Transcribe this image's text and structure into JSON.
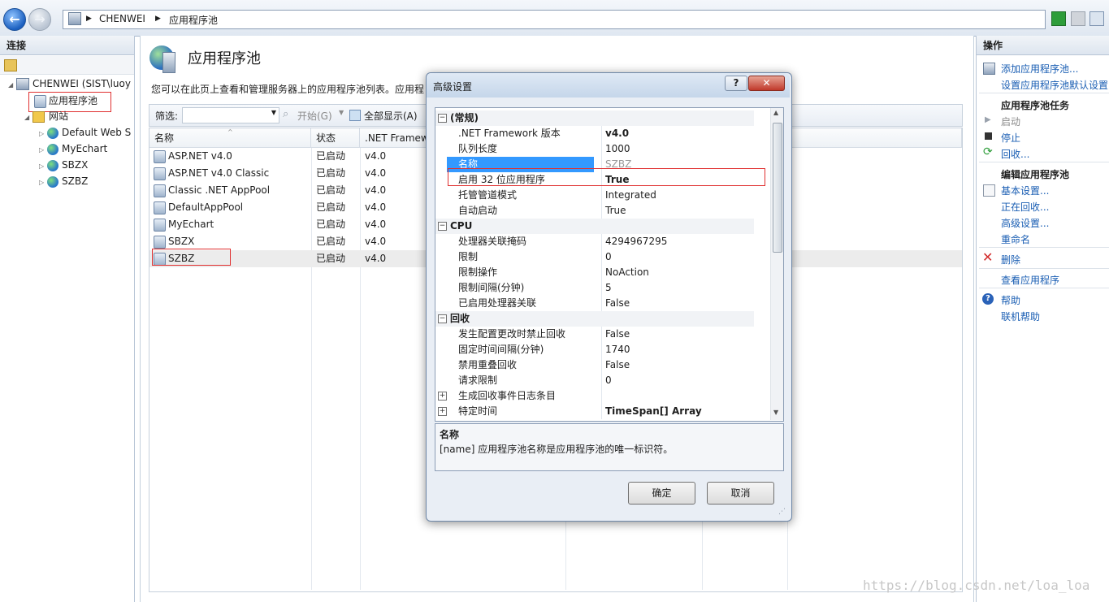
{
  "window": {
    "breadcrumb": [
      "CHENWEI",
      "应用程序池"
    ]
  },
  "connections": {
    "title": "连接",
    "server": "CHENWEI (SIST\\luoy",
    "app_pools": "应用程序池",
    "sites": "网站",
    "site_items": [
      "Default Web S",
      "MyEchart",
      "SBZX",
      "SZBZ"
    ]
  },
  "main": {
    "title": "应用程序池",
    "description": "您可以在此页上查看和管理服务器上的应用程序池列表。应用程",
    "filter_label": "筛选:",
    "start_label": "开始(G)",
    "show_all_label": "全部显示(A)",
    "columns": [
      "名称",
      "状态",
      ".NET Framew"
    ],
    "rows": [
      {
        "name": "ASP.NET v4.0",
        "status": "已启动",
        "net": "v4.0"
      },
      {
        "name": "ASP.NET v4.0 Classic",
        "status": "已启动",
        "net": "v4.0"
      },
      {
        "name": "Classic .NET AppPool",
        "status": "已启动",
        "net": "v4.0"
      },
      {
        "name": "DefaultAppPool",
        "status": "已启动",
        "net": "v4.0"
      },
      {
        "name": "MyEchart",
        "status": "已启动",
        "net": "v4.0"
      },
      {
        "name": "SBZX",
        "status": "已启动",
        "net": "v4.0"
      },
      {
        "name": "SZBZ",
        "status": "已启动",
        "net": "v4.0"
      }
    ]
  },
  "actions": {
    "title": "操作",
    "add_pool": "添加应用程序池...",
    "set_defaults": "设置应用程序池默认设置",
    "tasks_head": "应用程序池任务",
    "start": "启动",
    "stop": "停止",
    "recycle": "回收...",
    "edit_head": "编辑应用程序池",
    "basic_settings": "基本设置...",
    "recycling": "正在回收...",
    "advanced_settings": "高级设置...",
    "rename": "重命名",
    "delete": "删除",
    "view_apps": "查看应用程序",
    "help": "帮助",
    "online_help": "联机帮助"
  },
  "dialog": {
    "title": "高级设置",
    "help_btn": "?",
    "close_btn": "✕",
    "properties": [
      {
        "kind": "cat",
        "name": "(常规)"
      },
      {
        "kind": "prop",
        "name": ".NET Framework 版本",
        "value": "v4.0",
        "bold": true
      },
      {
        "kind": "prop",
        "name": "队列长度",
        "value": "1000"
      },
      {
        "kind": "prop",
        "name": "名称",
        "value": "SZBZ",
        "selected": true
      },
      {
        "kind": "prop",
        "name": "启用 32 位应用程序",
        "value": "True",
        "bold": true
      },
      {
        "kind": "prop",
        "name": "托管管道模式",
        "value": "Integrated"
      },
      {
        "kind": "prop",
        "name": "自动启动",
        "value": "True"
      },
      {
        "kind": "cat",
        "name": "CPU"
      },
      {
        "kind": "prop",
        "name": "处理器关联掩码",
        "value": "4294967295"
      },
      {
        "kind": "prop",
        "name": "限制",
        "value": "0"
      },
      {
        "kind": "prop",
        "name": "限制操作",
        "value": "NoAction"
      },
      {
        "kind": "prop",
        "name": "限制间隔(分钟)",
        "value": "5"
      },
      {
        "kind": "prop",
        "name": "已启用处理器关联",
        "value": "False"
      },
      {
        "kind": "cat",
        "name": "回收"
      },
      {
        "kind": "prop",
        "name": "发生配置更改时禁止回收",
        "value": "False"
      },
      {
        "kind": "prop",
        "name": "固定时间间隔(分钟)",
        "value": "1740"
      },
      {
        "kind": "prop",
        "name": "禁用重叠回收",
        "value": "False"
      },
      {
        "kind": "prop",
        "name": "请求限制",
        "value": "0"
      },
      {
        "kind": "sub",
        "name": "生成回收事件日志条目",
        "value": ""
      },
      {
        "kind": "sub",
        "name": "特定时间",
        "value": "TimeSpan[] Array",
        "bold": true
      }
    ],
    "desc_title": "名称",
    "desc_text": "[name] 应用程序池名称是应用程序池的唯一标识符。",
    "ok": "确定",
    "cancel": "取消"
  },
  "watermark": "https://blog.csdn.net/loa_loa"
}
